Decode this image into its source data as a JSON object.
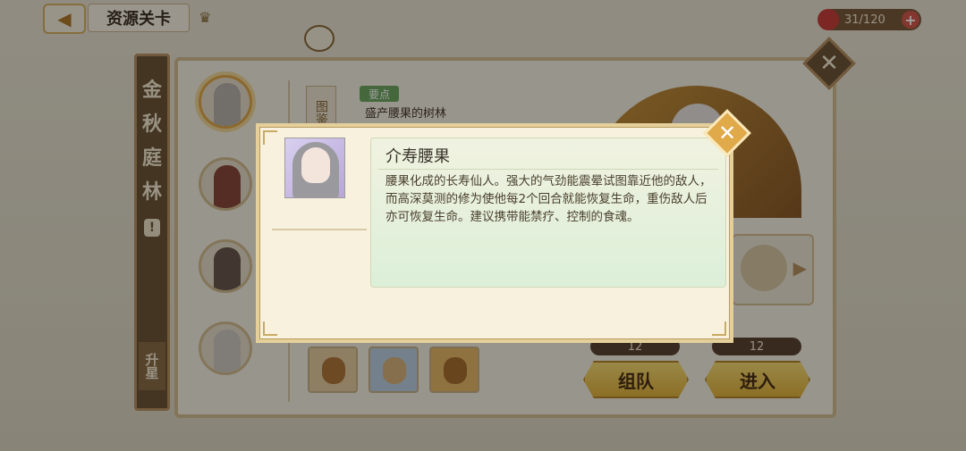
{
  "topbar": {
    "back_icon": "back-arrow-icon",
    "title": "资源关卡",
    "crown_icon": "crown-icon",
    "stamina": "31/120",
    "plus": "+"
  },
  "banner": {
    "chars": [
      "金",
      "秋",
      "庭",
      "林"
    ],
    "alert": "!",
    "upstar": "升星"
  },
  "stage": {
    "side_tab": "图鉴",
    "feature_tag": "要点",
    "feature_text": "盛产腰果的树林"
  },
  "counts": [
    "12",
    "12"
  ],
  "buttons": {
    "team": "组队",
    "enter": "进入"
  },
  "popup": {
    "title": "介寿腰果",
    "description": "腰果化成的长寿仙人。强大的气劲能震晕试图靠近他的敌人，而高深莫测的修为使他每2个回合就能恢复生命，重伤敌人后亦可恢复生命。建议携带能禁疗、控制的食魂。",
    "close": "✕"
  },
  "main_close": "✕",
  "colors": {
    "accent_gold": "#e0a94a",
    "panel_brown": "#6e5538",
    "button_yellow": "#f7dc74"
  }
}
